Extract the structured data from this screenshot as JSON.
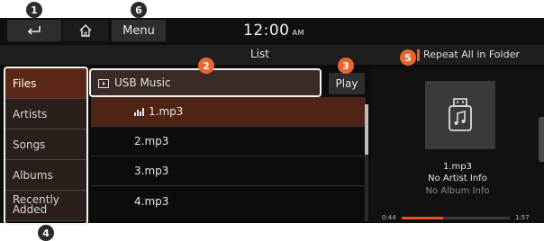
{
  "topbar": {
    "menu_label": "Menu",
    "clock_time": "12:00",
    "clock_ampm": "AM",
    "icons": [
      "back-icon",
      "home-icon"
    ]
  },
  "subbar": {
    "title": "List",
    "repeat_label": "Repeat All in Folder"
  },
  "categories": [
    {
      "label": "Files",
      "active": true
    },
    {
      "label": "Artists",
      "active": false
    },
    {
      "label": "Songs",
      "active": false
    },
    {
      "label": "Albums",
      "active": false
    },
    {
      "label": "Recently Added",
      "active": false
    }
  ],
  "path": {
    "folder_label": "USB Music",
    "play_label": "Play"
  },
  "files": [
    {
      "name": "1.mp3",
      "playing": true
    },
    {
      "name": "2.mp3",
      "playing": false
    },
    {
      "name": "3.mp3",
      "playing": false
    },
    {
      "name": "4.mp3",
      "playing": false
    }
  ],
  "now_playing": {
    "title": "1.mp3",
    "artist": "No Artist Info",
    "album": "No Album Info",
    "elapsed": "0:44",
    "total": "1:57",
    "progress": 0.38,
    "album_art_icon": "usb-music-icon"
  },
  "callouts": [
    "1",
    "2",
    "3",
    "4",
    "5",
    "6"
  ],
  "colors": {
    "accent": "#e9652f",
    "selected_row": "#4f2415",
    "active_category": "#5b2817",
    "category_bg": "#2b1f1b",
    "screen_bg": "#0c0c0c"
  }
}
